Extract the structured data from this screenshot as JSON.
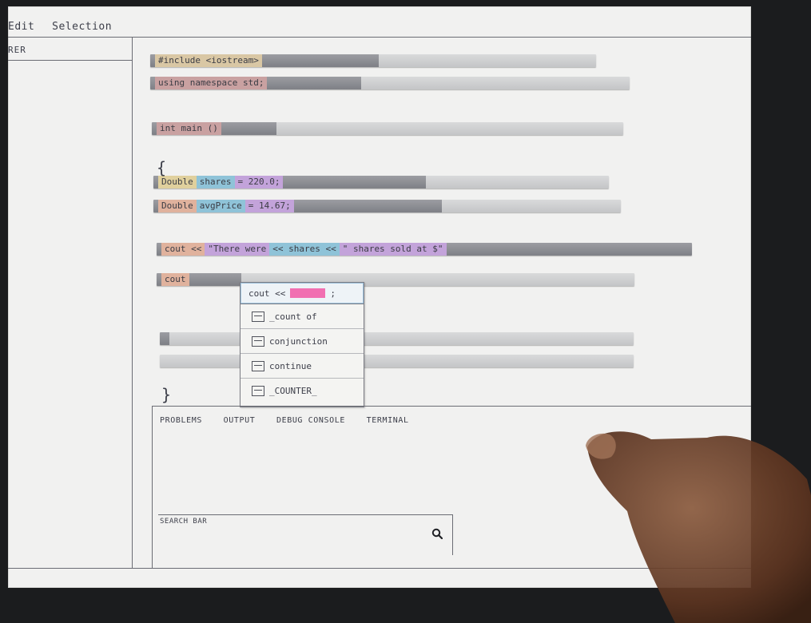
{
  "menubar": {
    "edit": "Edit",
    "selection": "Selection"
  },
  "explorer": {
    "label": "RER"
  },
  "editor": {
    "lines": [
      {
        "segments": [
          {
            "text": "#include <iostream>",
            "color": "#d9c7a4"
          }
        ]
      },
      {
        "segments": [
          {
            "text": "using namespace std;",
            "color": "#c9a1a1"
          }
        ]
      },
      {
        "segments": [
          {
            "text": "int main ()",
            "color": "#c9a1a1"
          }
        ]
      },
      {
        "segments": [
          {
            "text": "Double",
            "color": "#e0d09d"
          },
          {
            "text": "shares",
            "color": "#8fc3d8"
          },
          {
            "text": "= 220.0;",
            "color": "#c3a3da"
          }
        ]
      },
      {
        "segments": [
          {
            "text": "Double",
            "color": "#e0b29d"
          },
          {
            "text": "avgPrice",
            "color": "#8fc3d8"
          },
          {
            "text": "= 14.67;",
            "color": "#c3a3da"
          }
        ]
      },
      {
        "segments": [
          {
            "text": "cout <<",
            "color": "#e0b29d"
          },
          {
            "text": "\"There were",
            "color": "#c3a3da"
          },
          {
            "text": "<< shares <<",
            "color": "#8fc3d8"
          },
          {
            "text": "\" shares sold at $\"",
            "color": "#c3a3da"
          }
        ]
      },
      {
        "segments": [
          {
            "text": "cout",
            "color": "#e0b29d"
          }
        ]
      }
    ],
    "open_brace": "{",
    "close_brace": "}"
  },
  "autocomplete": {
    "typed_prefix": "cout <<",
    "typed_suffix": ";",
    "highlight_color": "#f16fb1",
    "items": [
      {
        "label": "_count of",
        "icon": "field-icon"
      },
      {
        "label": "conjunction",
        "icon": "snippet-icon"
      },
      {
        "label": "continue",
        "icon": "keyword-icon"
      },
      {
        "label": "_COUNTER_",
        "icon": "field-icon"
      }
    ]
  },
  "panel": {
    "tabs": [
      "PROBLEMS",
      "OUTPUT",
      "DEBUG CONSOLE",
      "TERMINAL"
    ],
    "search_label": "SEARCH BAR"
  }
}
